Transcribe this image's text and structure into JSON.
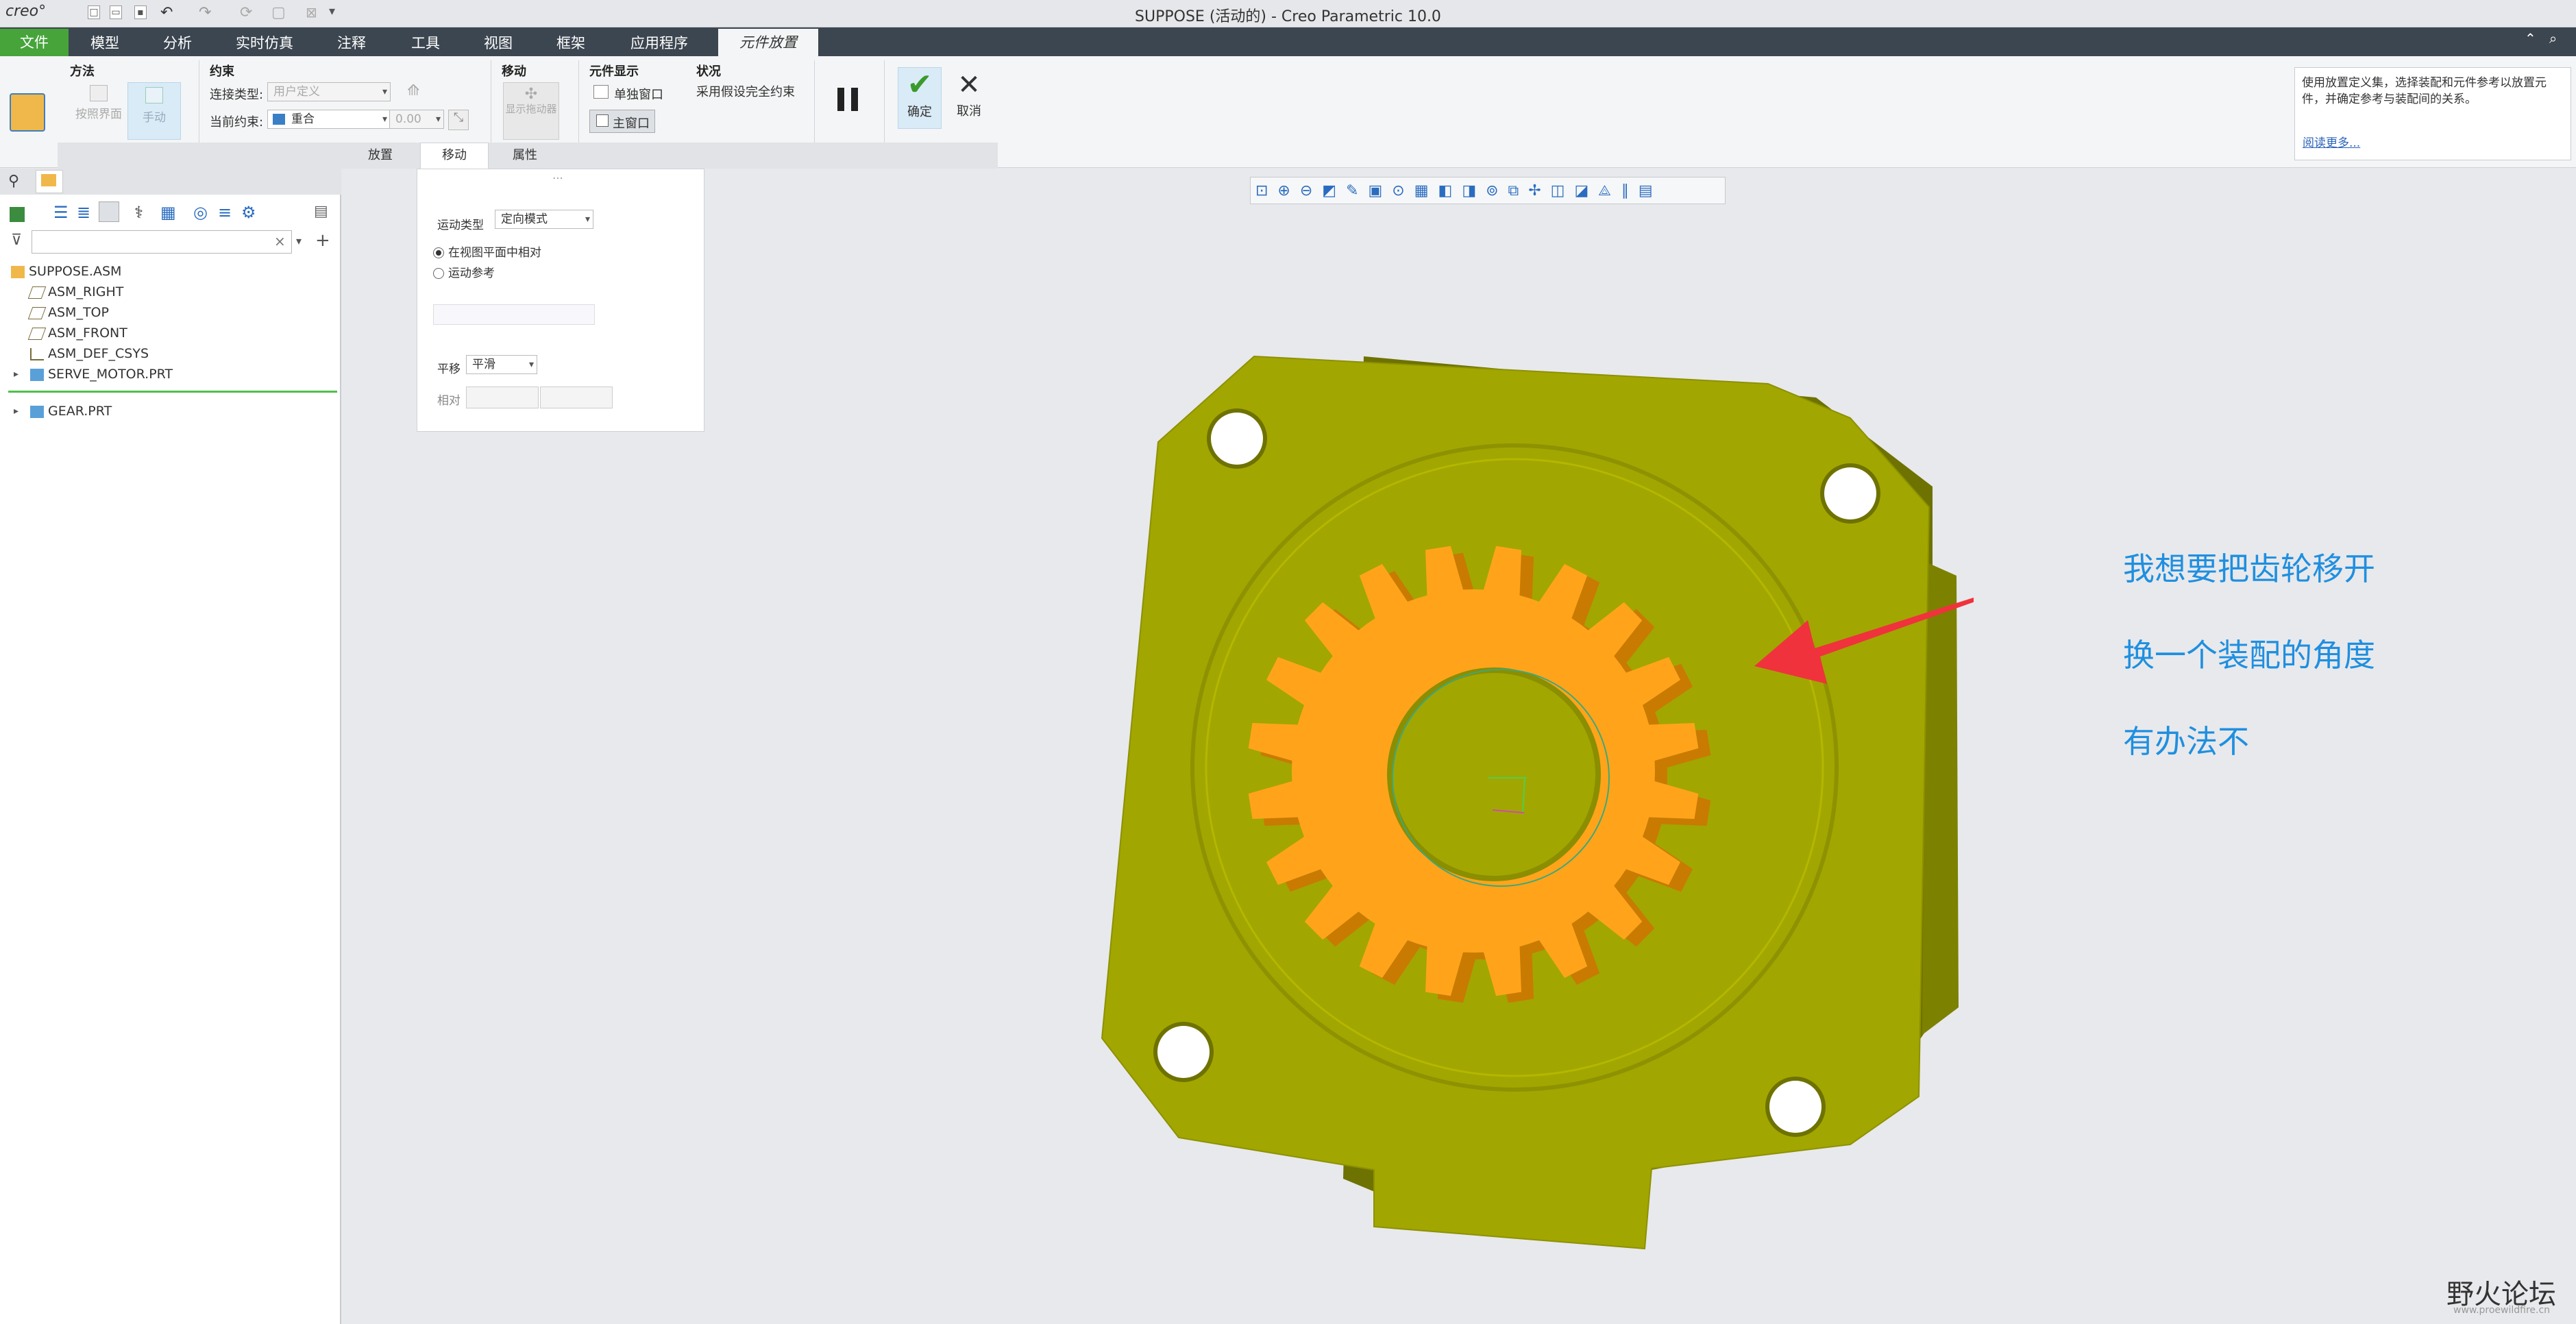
{
  "window": {
    "logo": "creo°",
    "title": "SUPPOSE (活动的) - Creo Parametric 10.0"
  },
  "menu": {
    "file": "文件",
    "items": [
      "模型",
      "分析",
      "实时仿真",
      "注释",
      "工具",
      "视图",
      "框架",
      "应用程序"
    ],
    "active": "元件放置"
  },
  "ribbon": {
    "method": {
      "title": "方法",
      "interface_btn": "按照界面",
      "manual_btn": "手动"
    },
    "constraint": {
      "title": "约束",
      "connection_label": "连接类型:",
      "connection_value": "用户定义",
      "current_label": "当前约束:",
      "current_value": "重合",
      "offset_value": "0.00"
    },
    "move": {
      "title": "移动",
      "drag_btn": "显示拖动器"
    },
    "display": {
      "title": "元件显示",
      "separate_window": "单独窗口",
      "main_window": "主窗口"
    },
    "status": {
      "title": "状况",
      "text": "采用假设完全约束"
    },
    "ok": "确定",
    "cancel": "取消",
    "subtabs": [
      "放置",
      "移动",
      "属性"
    ]
  },
  "help": {
    "text": "使用放置定义集，选择装配和元件参考以放置元件，并确定参考与装配间的关系。",
    "link": "阅读更多..."
  },
  "tree": {
    "root": "SUPPOSE.ASM",
    "items": [
      "ASM_RIGHT",
      "ASM_TOP",
      "ASM_FRONT",
      "ASM_DEF_CSYS",
      "SERVE_MOTOR.PRT"
    ],
    "placing": "GEAR.PRT"
  },
  "move_panel": {
    "motion_type_label": "运动类型",
    "motion_type_value": "定向模式",
    "radio_view_plane": "在视图平面中相对",
    "radio_motion_ref": "运动参考",
    "translate_label": "平移",
    "translate_value": "平滑",
    "relative_label": "相对"
  },
  "annotation": {
    "line1": "我想要把齿轮移开",
    "line2": "换一个装配的角度",
    "line3": "有办法不"
  },
  "watermark": {
    "text": "野火论坛",
    "url": "www.proewildfire.cn"
  },
  "colors": {
    "motor": "#a2a600",
    "motor_dark": "#6e7200",
    "gear": "#ffa41a",
    "gear_dark": "#c97a00",
    "arrow": "#f0323c",
    "annotation": "#1f8fe0"
  }
}
